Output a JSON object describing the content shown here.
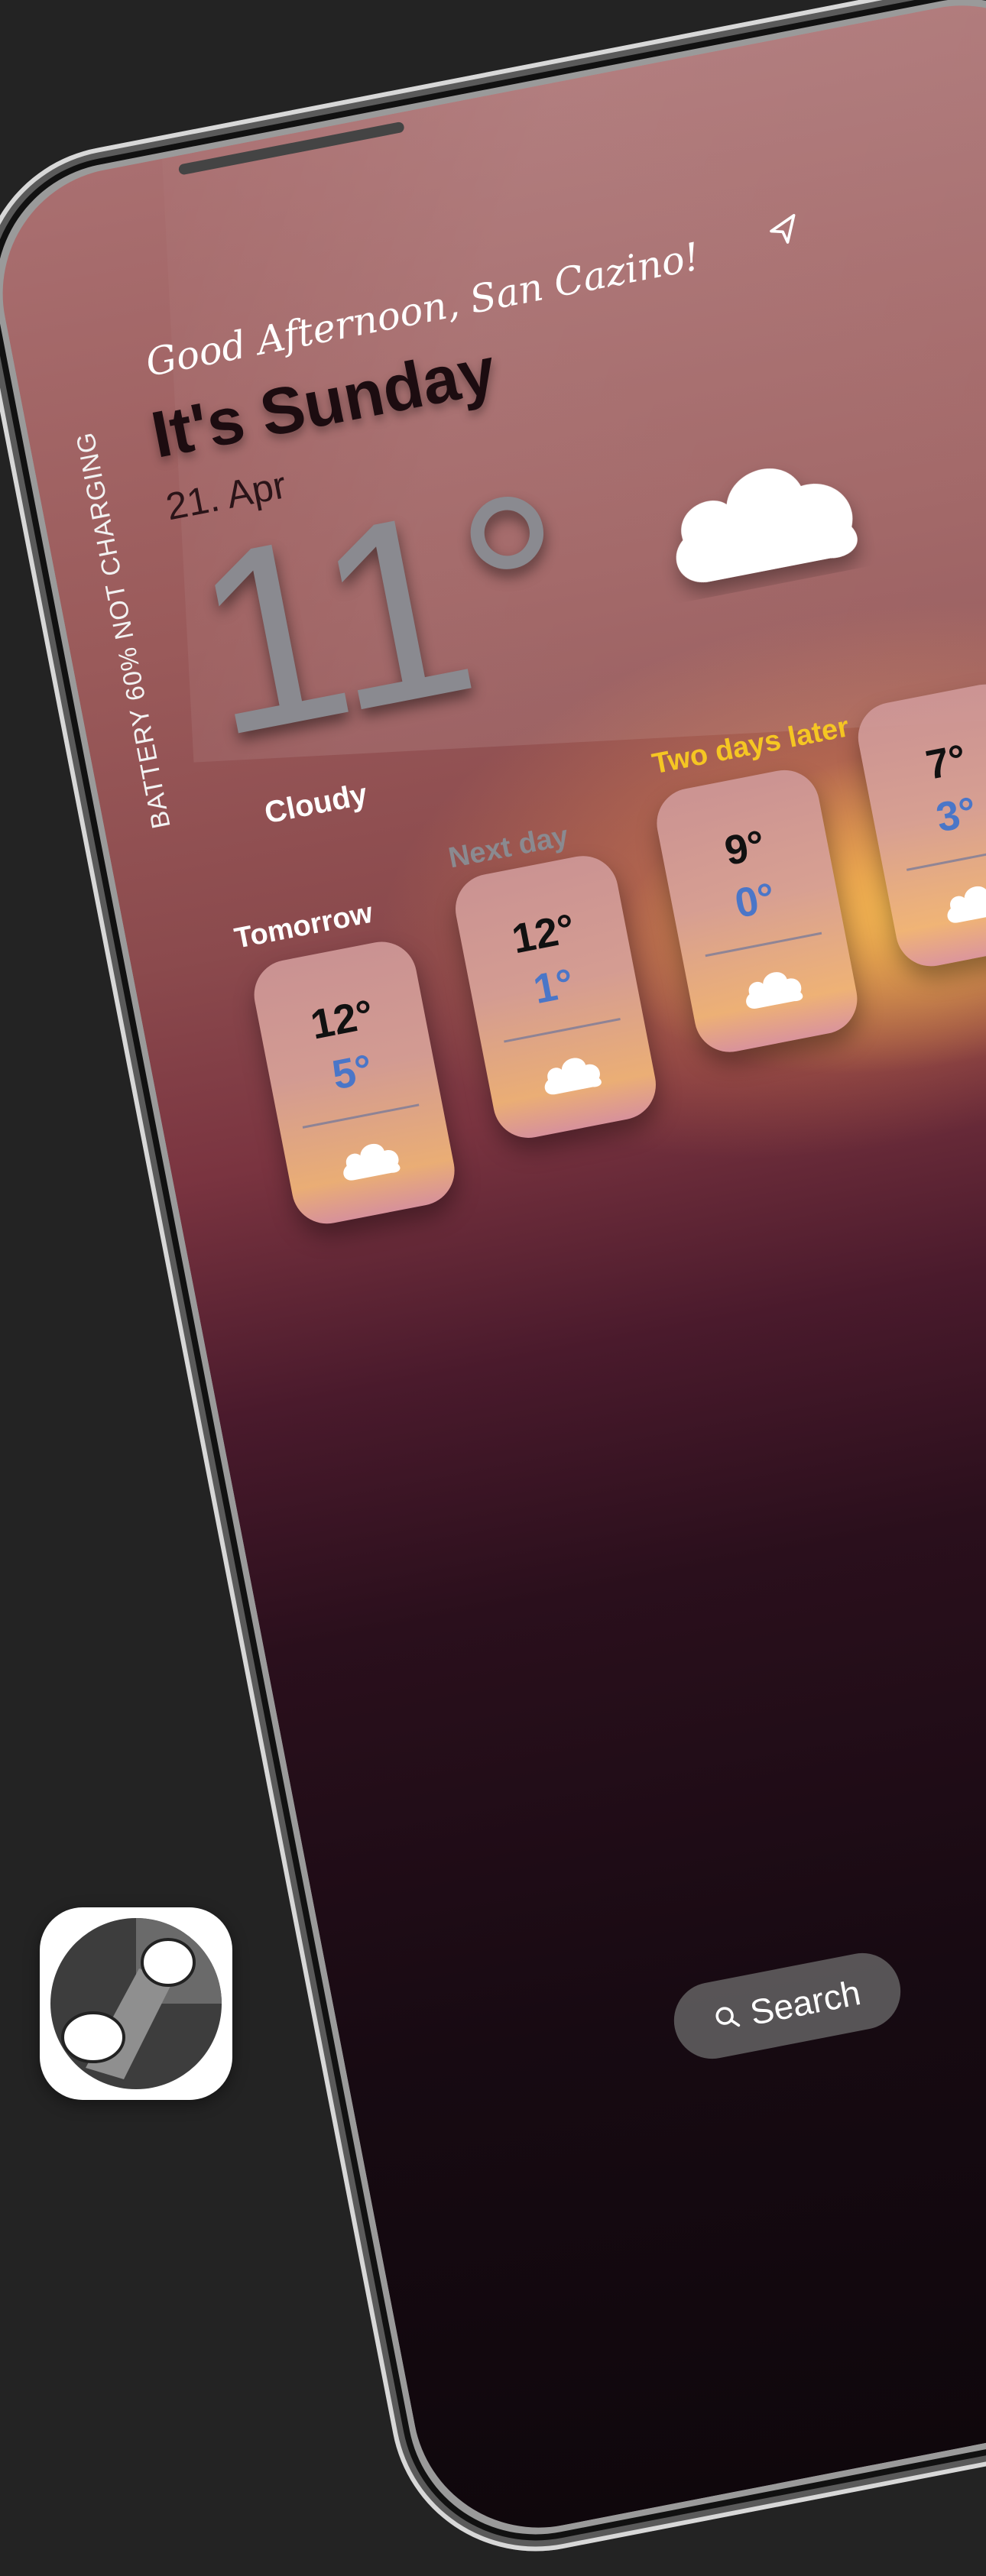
{
  "widget": {
    "greeting": "Good Afternoon, San Cazino!",
    "day": "It's Sunday",
    "date": "21. Apr",
    "temperature": "11°",
    "condition": "Cloudy",
    "battery": "BATTERY 60%  NOT CHARGING"
  },
  "forecast": [
    {
      "label": "Tomorrow",
      "label_color": "#ffffff",
      "high": "12°",
      "low": "5°",
      "icon": "cloud-icon"
    },
    {
      "label": "Next day",
      "label_color": "#8a8a90",
      "high": "12°",
      "low": "1°",
      "icon": "cloud-icon"
    },
    {
      "label": "Two days later",
      "label_color": "#f5c623",
      "high": "9°",
      "low": "0°",
      "icon": "cloud-icon"
    },
    {
      "label": "",
      "label_color": "",
      "high": "7°",
      "low": "3°",
      "icon": "cloud-icon"
    }
  ],
  "search": {
    "label": "Search",
    "icon": "search-icon"
  },
  "app_icon": {
    "icon": "app-logo-icon"
  }
}
